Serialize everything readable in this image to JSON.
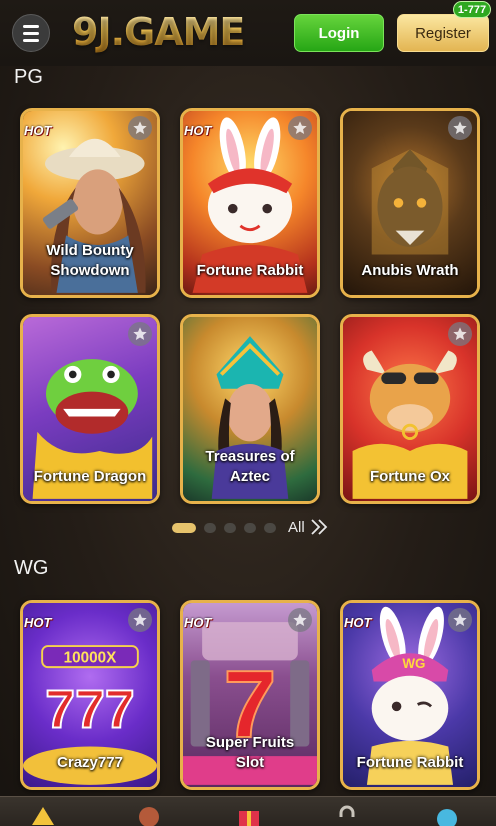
{
  "header": {
    "logo_text": "9J.GAME",
    "login_label": "Login",
    "register_label": "Register",
    "register_badge": "1-777"
  },
  "sections": [
    {
      "title": "PG",
      "games": [
        {
          "name": "Wild Bounty\nShowdown",
          "hot": "HOT"
        },
        {
          "name": "Fortune Rabbit",
          "hot": "HOT"
        },
        {
          "name": "Anubis Wrath",
          "hot": ""
        },
        {
          "name": "Fortune Dragon",
          "hot": ""
        },
        {
          "name": "Treasures of\nAztec",
          "hot": ""
        },
        {
          "name": "Fortune Ox",
          "hot": ""
        }
      ]
    },
    {
      "title": "WG",
      "games": [
        {
          "name": "Crazy777",
          "hot": "HOT"
        },
        {
          "name": "Super Fruits\nSlot",
          "hot": "HOT"
        },
        {
          "name": "Fortune Rabbit",
          "hot": "HOT"
        }
      ]
    }
  ],
  "pagination": {
    "all_label": "All",
    "pages": 5,
    "active_page": 1
  },
  "icons": [
    "menu-icon",
    "star-icon",
    "double-chevron-right-icon"
  ],
  "colors": {
    "card_border": "#e7b24b",
    "login": "#33b51f",
    "register": "#f0cb73",
    "active_dot": "#e6c36c"
  }
}
